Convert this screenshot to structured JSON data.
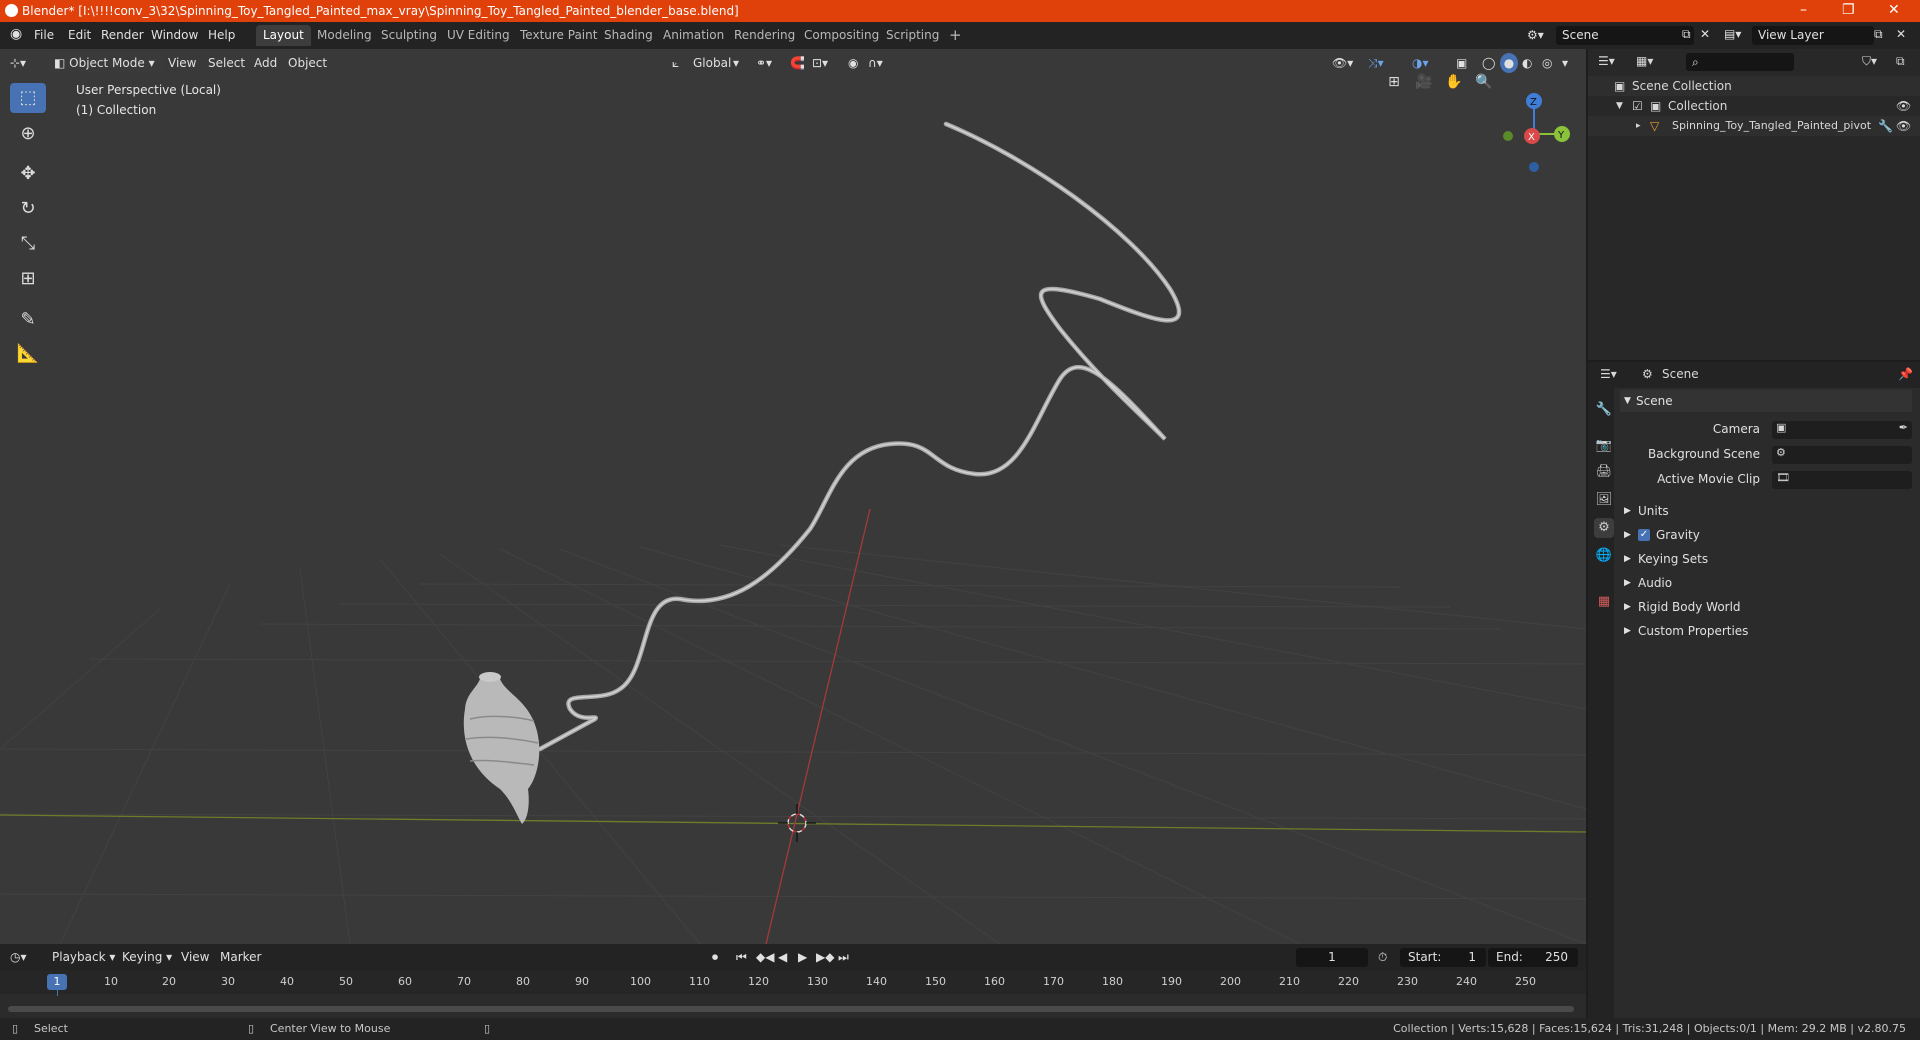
{
  "title": "Blender* [I:\\!!!!conv_3\\32\\Spinning_Toy_Tangled_Painted_max_vray\\Spinning_Toy_Tangled_Painted_blender_base.blend]",
  "menus": [
    "File",
    "Edit",
    "Render",
    "Window",
    "Help"
  ],
  "workspaces": [
    "Layout",
    "Modeling",
    "Sculpting",
    "UV Editing",
    "Texture Paint",
    "Shading",
    "Animation",
    "Rendering",
    "Compositing",
    "Scripting"
  ],
  "active_workspace": "Layout",
  "scene_name": "Scene",
  "view_layer": "View Layer",
  "viewport": {
    "mode": "Object Mode",
    "menus": [
      "View",
      "Select",
      "Add",
      "Object"
    ],
    "transform_orientation": "Global",
    "perspective": "User Perspective (Local)",
    "collection": "(1) Collection",
    "gizmo": {
      "z": "Z",
      "x": "X",
      "y": "Y"
    }
  },
  "outliner": {
    "root": "Scene Collection",
    "collection": "Collection",
    "object": "Spinning_Toy_Tangled_Painted_pivot"
  },
  "properties": {
    "header": "Scene",
    "panel": "Scene",
    "camera_label": "Camera",
    "background_scene_label": "Background Scene",
    "movie_clip_label": "Active Movie Clip",
    "sections": [
      "Units",
      "Gravity",
      "Keying Sets",
      "Audio",
      "Rigid Body World",
      "Custom Properties"
    ],
    "gravity_checked": true
  },
  "timeline": {
    "menus": [
      "Playback",
      "Keying",
      "View",
      "Marker"
    ],
    "current_frame": "1",
    "start_label": "Start:",
    "start": "1",
    "end_label": "End:",
    "end": "250",
    "ticks": [
      "1",
      "10",
      "20",
      "30",
      "40",
      "50",
      "60",
      "70",
      "80",
      "90",
      "100",
      "110",
      "120",
      "130",
      "140",
      "150",
      "160",
      "170",
      "180",
      "190",
      "200",
      "210",
      "220",
      "230",
      "240",
      "250"
    ]
  },
  "status": {
    "select": "Select",
    "center": "Center View to Mouse",
    "stats": "Collection | Verts:15,628 | Faces:15,624 | Tris:31,248 | Objects:0/1 | Mem: 29.2 MB | v2.80.75"
  },
  "colors": {
    "title_bar": "#e0400a",
    "accent": "#4772b3",
    "viewport_bg": "#393939"
  }
}
